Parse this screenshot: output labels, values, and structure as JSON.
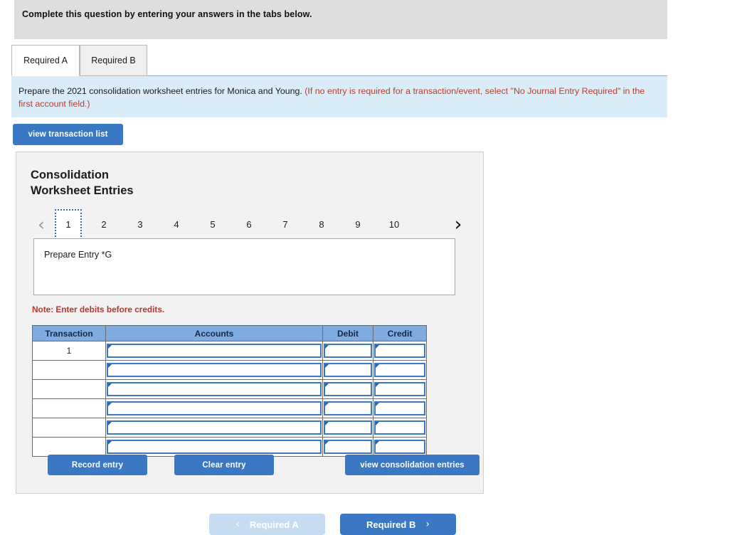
{
  "question": {
    "prompt": "Complete this question by entering your answers in the tabs below."
  },
  "tabs": [
    {
      "label": "Required A",
      "active": true
    },
    {
      "label": "Required B",
      "active": false
    }
  ],
  "requirement": {
    "main_text": "Prepare the 2021 consolidation worksheet entries for Monica and Young.",
    "hint_text": "(If no entry is required for a transaction/event, select \"No Journal Entry Required\" in the first account field.)"
  },
  "toolbar": {
    "view_transaction_list_label": "view transaction list"
  },
  "panel": {
    "title_line1": "Consolidation",
    "title_line2": "Worksheet Entries",
    "pager": {
      "prev_icon": "chevron-left-icon",
      "prev_glyph": "‹",
      "next_icon": "chevron-right-icon",
      "next_glyph": "›",
      "current": "1",
      "pages": [
        "1",
        "2",
        "3",
        "4",
        "5",
        "6",
        "7",
        "8",
        "9",
        "10"
      ]
    },
    "description": "Prepare Entry *G",
    "note": "Note: Enter debits before credits.",
    "table": {
      "columns": [
        "Transaction",
        "Accounts",
        "Debit",
        "Credit"
      ],
      "rows": [
        {
          "transaction": "1",
          "accounts": "",
          "debit": "",
          "credit": ""
        },
        {
          "transaction": "",
          "accounts": "",
          "debit": "",
          "credit": ""
        },
        {
          "transaction": "",
          "accounts": "",
          "debit": "",
          "credit": ""
        },
        {
          "transaction": "",
          "accounts": "",
          "debit": "",
          "credit": ""
        },
        {
          "transaction": "",
          "accounts": "",
          "debit": "",
          "credit": ""
        },
        {
          "transaction": "",
          "accounts": "",
          "debit": "",
          "credit": ""
        }
      ]
    },
    "buttons": {
      "record_entry": "Record entry",
      "clear_entry": "Clear entry",
      "view_consolidation_entries": "view consolidation entries"
    }
  },
  "bottom_nav": {
    "prev_label": "Required A",
    "prev_glyph": "‹",
    "next_label": "Required B",
    "next_glyph": "›"
  },
  "colors": {
    "accent_blue": "#3b78c3",
    "banner_blue": "#d9ecf8",
    "table_header_blue": "#7fabdf",
    "hint_red": "#c0392b",
    "note_red": "#b5352b",
    "panel_gray": "#f2f2f2",
    "question_bar_gray": "#dedede",
    "nav_disabled_blue": "#c6dcf0"
  }
}
